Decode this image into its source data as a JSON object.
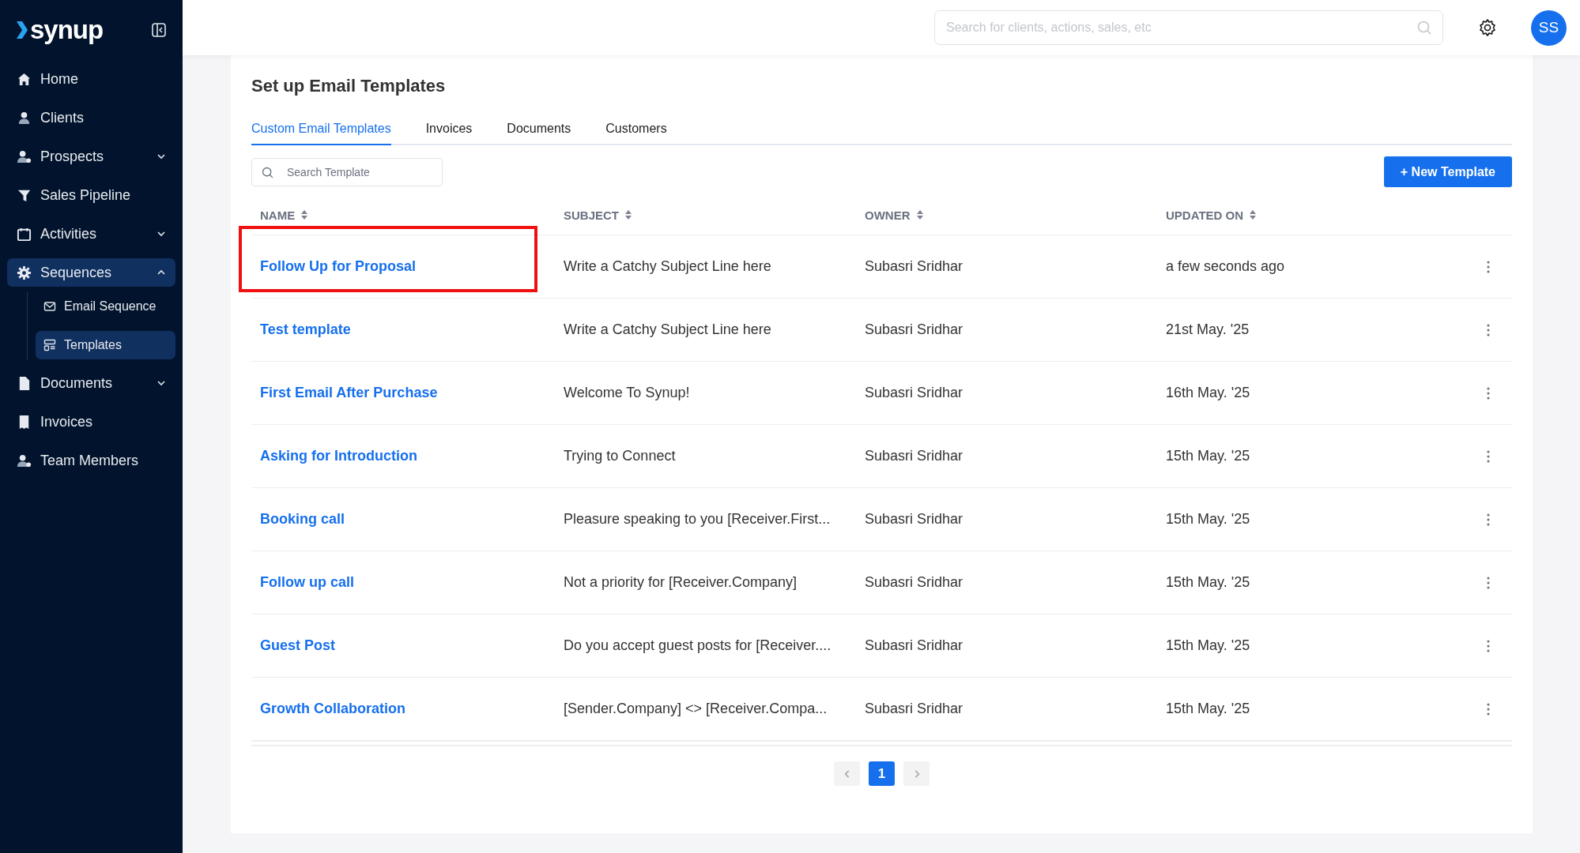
{
  "sidebar": {
    "logo": "synup",
    "items": [
      {
        "label": "Home",
        "selected": false
      },
      {
        "label": "Clients",
        "selected": false
      },
      {
        "label": "Prospects",
        "expanded": false,
        "selected": false
      },
      {
        "label": "Sales Pipeline",
        "selected": false
      },
      {
        "label": "Activities",
        "expanded": false,
        "selected": false
      },
      {
        "label": "Sequences",
        "expanded": true,
        "selected": true,
        "children": [
          {
            "label": "Email Sequence",
            "selected": false
          },
          {
            "label": "Templates",
            "selected": true
          }
        ]
      },
      {
        "label": "Documents",
        "expanded": false,
        "selected": false
      },
      {
        "label": "Invoices",
        "selected": false
      },
      {
        "label": "Team Members",
        "selected": false
      }
    ]
  },
  "top_bar": {
    "search": {
      "placeholder": "Search for clients, actions, sales, etc"
    },
    "avatar": "SS"
  },
  "page": {
    "title": "Set up Email Templates",
    "tabs": [
      {
        "label": "Custom Email Templates",
        "selected": true
      },
      {
        "label": "Invoices",
        "selected": false
      },
      {
        "label": "Documents",
        "selected": false
      },
      {
        "label": "Customers",
        "selected": false
      }
    ],
    "search": {
      "placeholder": "Search Template"
    },
    "new_button": "+ New Template"
  },
  "table": {
    "columns": [
      "NAME",
      "SUBJECT",
      "OWNER",
      "UPDATED ON"
    ],
    "rows": [
      {
        "name": "Follow Up for Proposal",
        "subject": "Write a Catchy Subject Line here",
        "owner": "Subasri Sridhar",
        "updated": "a few seconds ago",
        "highlighted": true
      },
      {
        "name": "Test template",
        "subject": "Write a Catchy Subject Line here",
        "owner": "Subasri Sridhar",
        "updated": "21st May. '25",
        "highlighted": false
      },
      {
        "name": "First Email After Purchase",
        "subject": "Welcome To Synup!",
        "owner": "Subasri Sridhar",
        "updated": "16th May. '25",
        "highlighted": false
      },
      {
        "name": "Asking for Introduction",
        "subject": "Trying to Connect",
        "owner": "Subasri Sridhar",
        "updated": "15th May. '25",
        "highlighted": false
      },
      {
        "name": "Booking call",
        "subject": "Pleasure speaking to you [Receiver.First...",
        "owner": "Subasri Sridhar",
        "updated": "15th May. '25",
        "highlighted": false
      },
      {
        "name": "Follow up call",
        "subject": "Not a priority for [Receiver.Company]",
        "owner": "Subasri Sridhar",
        "updated": "15th May. '25",
        "highlighted": false
      },
      {
        "name": "Guest Post",
        "subject": "Do you accept guest posts for [Receiver....",
        "owner": "Subasri Sridhar",
        "updated": "15th May. '25",
        "highlighted": false
      },
      {
        "name": "Growth Collaboration",
        "subject": "[Sender.Company] <> [Receiver.Compa...",
        "owner": "Subasri Sridhar",
        "updated": "15th May. '25",
        "highlighted": false
      }
    ]
  },
  "pagination": {
    "pages": [
      {
        "label": "1",
        "selected": true
      }
    ]
  }
}
